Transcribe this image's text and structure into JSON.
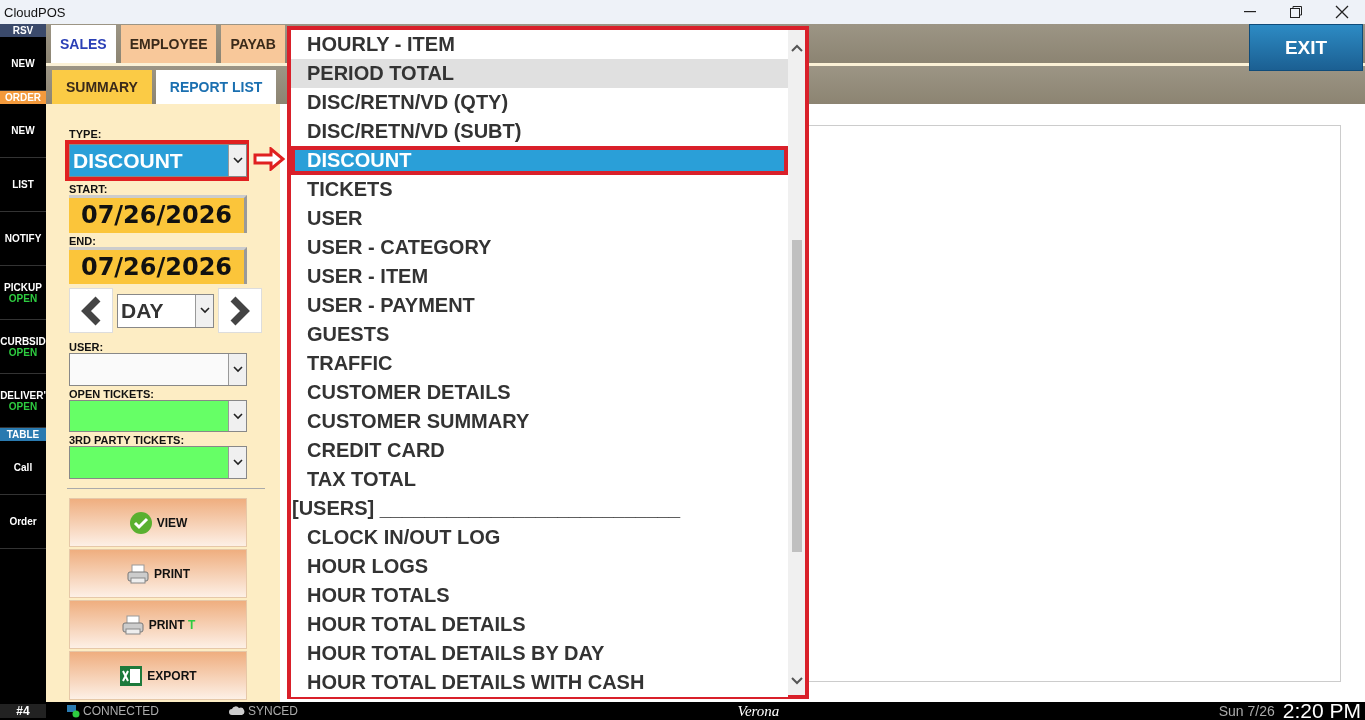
{
  "window": {
    "title": "CloudPOS"
  },
  "sidebar": [
    {
      "kind": "band",
      "label": "RSV",
      "color": "#3b4a6b"
    },
    {
      "kind": "button",
      "label": "NEW"
    },
    {
      "kind": "band",
      "label": "ORDER",
      "color": "#f39a3c"
    },
    {
      "kind": "button",
      "label": "NEW"
    },
    {
      "kind": "button",
      "label": "LIST"
    },
    {
      "kind": "button",
      "label": "NOTIFY"
    },
    {
      "kind": "button",
      "label": "PICKUP",
      "status": "OPEN"
    },
    {
      "kind": "button",
      "label": "CURBSID",
      "status": "OPEN"
    },
    {
      "kind": "button",
      "label": "DELIVER'",
      "status": "OPEN"
    },
    {
      "kind": "band",
      "label": "TABLE",
      "color": "#2a7ab0"
    },
    {
      "kind": "button",
      "label": "Call"
    },
    {
      "kind": "button",
      "label": "Order"
    }
  ],
  "tabs": [
    {
      "label": "SALES",
      "selected": true
    },
    {
      "label": "EMPLOYEE",
      "selected": false
    },
    {
      "label": "PAYAB",
      "selected": false
    }
  ],
  "subtabs": [
    {
      "label": "SUMMARY",
      "selected": false
    },
    {
      "label": "REPORT LIST",
      "selected": true
    }
  ],
  "exit_button": "EXIT",
  "form": {
    "type_label": "TYPE:",
    "type_value": "DISCOUNT",
    "start_label": "START:",
    "start_date": "07/26/2026",
    "end_label": "END:",
    "end_date": "07/26/2026",
    "period_value": "DAY",
    "user_label": "USER:",
    "open_tickets_label": "OPEN TICKETS:",
    "third_party_label": "3RD PARTY TICKETS:"
  },
  "actions": [
    {
      "kind": "view",
      "label": "VIEW"
    },
    {
      "kind": "print",
      "label": "PRINT"
    },
    {
      "kind": "print",
      "label": "PRINT",
      "suffix": "T"
    },
    {
      "kind": "export",
      "label": "EXPORT"
    }
  ],
  "dropdown": [
    {
      "kind": "item",
      "label": "HOURLY - ITEM",
      "selected": false,
      "hovered": false
    },
    {
      "kind": "item",
      "label": "PERIOD TOTAL",
      "selected": false,
      "hovered": true
    },
    {
      "kind": "item",
      "label": "DISC/RETN/VD (QTY)",
      "selected": false,
      "hovered": false
    },
    {
      "kind": "item",
      "label": "DISC/RETN/VD (SUBT)",
      "selected": false,
      "hovered": false
    },
    {
      "kind": "item",
      "label": "DISCOUNT",
      "selected": true,
      "hovered": false
    },
    {
      "kind": "item",
      "label": "TICKETS",
      "selected": false,
      "hovered": false
    },
    {
      "kind": "item",
      "label": "USER",
      "selected": false,
      "hovered": false
    },
    {
      "kind": "item",
      "label": "USER - CATEGORY",
      "selected": false,
      "hovered": false
    },
    {
      "kind": "item",
      "label": "USER - ITEM",
      "selected": false,
      "hovered": false
    },
    {
      "kind": "item",
      "label": "USER - PAYMENT",
      "selected": false,
      "hovered": false
    },
    {
      "kind": "item",
      "label": "GUESTS",
      "selected": false,
      "hovered": false
    },
    {
      "kind": "item",
      "label": "TRAFFIC",
      "selected": false,
      "hovered": false
    },
    {
      "kind": "item",
      "label": "CUSTOMER DETAILS",
      "selected": false,
      "hovered": false
    },
    {
      "kind": "item",
      "label": "CUSTOMER SUMMARY",
      "selected": false,
      "hovered": false
    },
    {
      "kind": "item",
      "label": "CREDIT CARD",
      "selected": false,
      "hovered": false
    },
    {
      "kind": "item",
      "label": "TAX TOTAL",
      "selected": false,
      "hovered": false
    },
    {
      "kind": "header",
      "label": "[USERS] ___________________________",
      "selected": false,
      "hovered": false
    },
    {
      "kind": "item",
      "label": "CLOCK IN/OUT LOG",
      "selected": false,
      "hovered": false
    },
    {
      "kind": "item",
      "label": "HOUR LOGS",
      "selected": false,
      "hovered": false
    },
    {
      "kind": "item",
      "label": "HOUR TOTALS",
      "selected": false,
      "hovered": false
    },
    {
      "kind": "item",
      "label": "HOUR TOTAL DETAILS",
      "selected": false,
      "hovered": false
    },
    {
      "kind": "item",
      "label": "HOUR TOTAL DETAILS BY DAY",
      "selected": false,
      "hovered": false
    },
    {
      "kind": "item",
      "label": "HOUR TOTAL DETAILS WITH CASH",
      "selected": false,
      "hovered": false
    }
  ],
  "status_bar": {
    "station": "#4",
    "connection": "CONNECTED",
    "sync": "SYNCED",
    "location": "Verona",
    "date": "Sun 7/26",
    "time": "2:20 PM"
  }
}
